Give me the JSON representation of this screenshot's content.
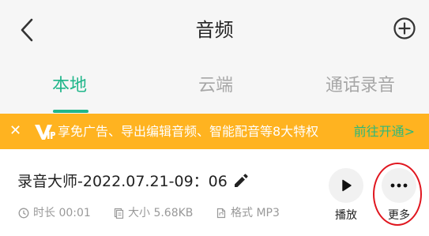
{
  "header": {
    "title": "音频"
  },
  "tabs": [
    {
      "label": "本地",
      "active": true
    },
    {
      "label": "云端",
      "active": false
    },
    {
      "label": "通话录音",
      "active": false
    }
  ],
  "vip_banner": {
    "close_symbol": "✕",
    "text": "享免广告、导出编辑音频、智能配音等8大特权",
    "link": "前往开通>"
  },
  "recording": {
    "name": "录音大师-2022.07.21-09：06",
    "duration": "时长 00:01",
    "size": "大小 5.68KB",
    "format": "格式 MP3",
    "play_label": "播放",
    "more_label": "更多"
  },
  "colors": {
    "accent": "#20b68a",
    "banner": "#ffb320",
    "highlight_ring": "#e0161f"
  },
  "icons": [
    "back-arrow-icon",
    "add-circle-icon",
    "close-icon",
    "vip-icon",
    "edit-icon",
    "clock-icon",
    "file-size-icon",
    "file-format-icon",
    "play-icon",
    "more-dots-icon"
  ]
}
